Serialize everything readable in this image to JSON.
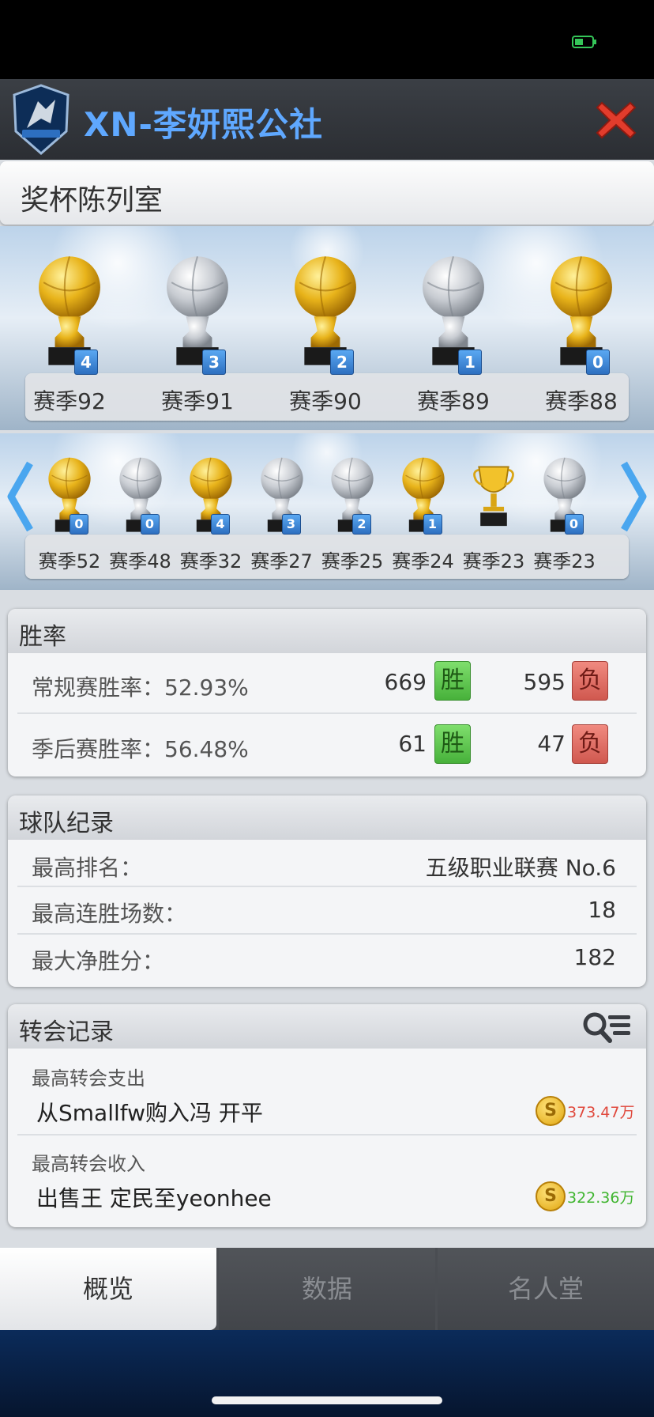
{
  "header": {
    "club_name": "XN-李妍熙公社",
    "close_label": "close"
  },
  "trophy_room": {
    "title": "奖杯陈列室",
    "top_row": [
      {
        "season": "赛季92",
        "count": "4",
        "type": "gold"
      },
      {
        "season": "赛季91",
        "count": "3",
        "type": "silver"
      },
      {
        "season": "赛季90",
        "count": "2",
        "type": "gold"
      },
      {
        "season": "赛季89",
        "count": "1",
        "type": "silver"
      },
      {
        "season": "赛季88",
        "count": "0",
        "type": "gold"
      }
    ],
    "bottom_row": [
      {
        "season": "赛季52",
        "count": "0",
        "type": "gold"
      },
      {
        "season": "赛季48",
        "count": "0",
        "type": "silver"
      },
      {
        "season": "赛季32",
        "count": "4",
        "type": "gold"
      },
      {
        "season": "赛季27",
        "count": "3",
        "type": "silver"
      },
      {
        "season": "赛季25",
        "count": "2",
        "type": "silver"
      },
      {
        "season": "赛季24",
        "count": "1",
        "type": "gold"
      },
      {
        "season": "赛季23",
        "count": "",
        "type": "cup"
      },
      {
        "season": "赛季23",
        "count": "0",
        "type": "silver"
      }
    ]
  },
  "win_rate": {
    "title": "胜率",
    "regular": {
      "label": "常规赛胜率：52.93%",
      "wins": "669",
      "win_tag": "胜",
      "losses": "595",
      "loss_tag": "负"
    },
    "playoff": {
      "label": "季后赛胜率：56.48%",
      "wins": "61",
      "win_tag": "胜",
      "losses": "47",
      "loss_tag": "负"
    }
  },
  "team_record": {
    "title": "球队纪录",
    "rows": [
      {
        "label": "最高排名：",
        "value": "五级职业联赛 No.6"
      },
      {
        "label": "最高连胜场数：",
        "value": "18"
      },
      {
        "label": "最大净胜分：",
        "value": "182"
      }
    ]
  },
  "transfer_record": {
    "title": "转会记录",
    "spend": {
      "label": "最高转会支出",
      "detail": "从Smallfw购入冯 开平",
      "amount": "373.47万",
      "amount_color": "#e0483c"
    },
    "income": {
      "label": "最高转会收入",
      "detail": "出售王 定民至yeonhee",
      "amount": "322.36万",
      "amount_color": "#3fb52f"
    },
    "coin_glyph": "S"
  },
  "tabs": {
    "overview": "概览",
    "data": "数据",
    "hall_of_fame": "名人堂"
  }
}
